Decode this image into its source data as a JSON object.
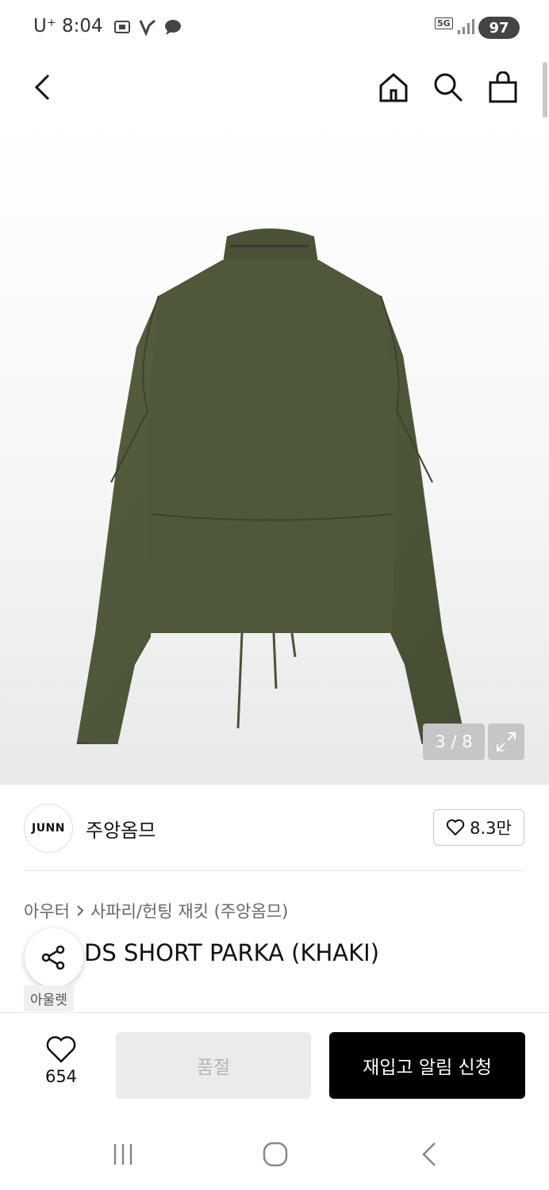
{
  "status_bar": {
    "carrier": "U⁺",
    "time": "8:04",
    "network": "5G",
    "battery": "97"
  },
  "header": {
    "icons": [
      "back-icon",
      "home-icon",
      "search-icon",
      "shopping-bag-icon"
    ]
  },
  "gallery": {
    "page_indicator": "3 / 8",
    "current_page": 3,
    "total_pages": 8
  },
  "brand": {
    "logo_text": "JUNN",
    "name": "주앙옴므",
    "likes": "8.3만"
  },
  "product": {
    "breadcrumb_category": "아우터",
    "breadcrumb_sub": "사파리/헌팅 재킷 (주앙옴므)",
    "title": "MODS SHORT PARKA (KHAKI)",
    "title_visible": "DS SHORT PARKA (KHAKI)",
    "tag": "아울렛"
  },
  "actions": {
    "wish_count": "654",
    "soldout_label": "품절",
    "restock_label": "재입고 알림 신청"
  },
  "colors": {
    "accent": "#000000",
    "jacket": "#4b5538"
  }
}
